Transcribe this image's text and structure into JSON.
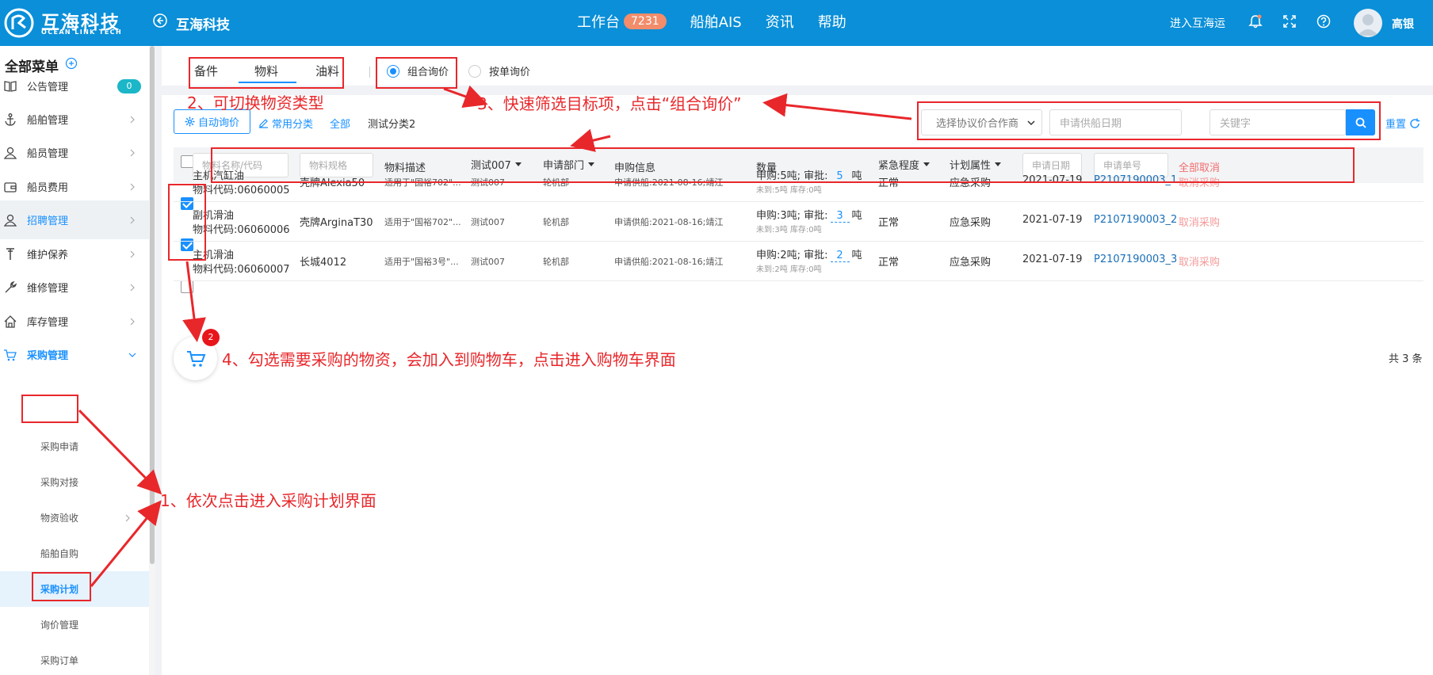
{
  "header": {
    "logo_cn": "互海科技",
    "logo_en": "OCEAN LINK TECH",
    "company": "互海科技",
    "nav": [
      {
        "label": "工作台",
        "badge": "7231"
      },
      {
        "label": "船舶AIS"
      },
      {
        "label": "资讯"
      },
      {
        "label": "帮助"
      }
    ],
    "enter_link": "进入互海运",
    "user_name": "高银",
    "colors": {
      "bar": "#0a8fd8",
      "badge": "#f28c6a"
    }
  },
  "sidebar": {
    "title": "全部菜单",
    "items": [
      {
        "label": "公告管理",
        "icon": "book-icon",
        "badge": "0"
      },
      {
        "label": "船舶管理",
        "icon": "anchor-icon"
      },
      {
        "label": "船员管理",
        "icon": "user-icon"
      },
      {
        "label": "船员费用",
        "icon": "wallet-icon"
      },
      {
        "label": "招聘管理",
        "icon": "user-icon"
      },
      {
        "label": "维护保养",
        "icon": "tool-icon"
      },
      {
        "label": "维修管理",
        "icon": "wrench-icon"
      },
      {
        "label": "库存管理",
        "icon": "home-icon"
      },
      {
        "label": "采购管理",
        "icon": "cart-icon"
      }
    ],
    "sub_items": [
      "采购申请",
      "采购对接",
      "物资验收",
      "船舶自购",
      "采购计划",
      "询价管理",
      "采购订单"
    ]
  },
  "tabs": [
    "备件",
    "物料",
    "油料"
  ],
  "radios": [
    "组合询价",
    "按单询价"
  ],
  "toolbar": {
    "auto_inquiry": "自动询价",
    "common_category": "常用分类",
    "all": "全部",
    "test_category": "测试分类2",
    "supplier_select": "选择协议价合作商",
    "date_placeholder": "申请供船日期",
    "keyword_placeholder": "关键字",
    "reset": "重置"
  },
  "table": {
    "headers": {
      "name_placeholder": "物料名称/代码",
      "spec_placeholder": "物料规格",
      "desc": "物料描述",
      "test007": "测试007",
      "dept": "申请部门",
      "info": "申购信息",
      "qty": "数量",
      "urgency": "紧急程度",
      "plan_attr": "计划属性",
      "date_placeholder": "申请日期",
      "no_placeholder": "申请单号",
      "cancel_all": "全部取消"
    },
    "rows": [
      {
        "name": "主机汽缸油",
        "code": "物料代码:06060005",
        "spec": "壳牌Alexia50",
        "desc": "适用于\"国裕702\"...",
        "test": "测试007",
        "dept": "轮机部",
        "info": "申请供船:2021-08-16;靖江",
        "apply": "申购:5吨; 审批:",
        "approve": "5",
        "unit": "吨",
        "sub": "未到:5吨 库存:0吨",
        "urgency": "正常",
        "attr": "应急采购",
        "date": "2021-07-19",
        "no": "P2107190003_1",
        "action": "取消采购",
        "checked": true
      },
      {
        "name": "副机滑油",
        "code": "物料代码:06060006",
        "spec": "壳牌ArginaT30",
        "desc": "适用于\"国裕702\"...",
        "test": "测试007",
        "dept": "轮机部",
        "info": "申请供船:2021-08-16;靖江",
        "apply": "申购:3吨; 审批:",
        "approve": "3",
        "unit": "吨",
        "sub": "未到:3吨 库存:0吨",
        "urgency": "正常",
        "attr": "应急采购",
        "date": "2021-07-19",
        "no": "P2107190003_2",
        "action": "取消采购",
        "checked": true
      },
      {
        "name": "主机滑油",
        "code": "物料代码:06060007",
        "spec": "长城4012",
        "desc": "适用于\"国裕3号\"...",
        "test": "测试007",
        "dept": "轮机部",
        "info": "申请供船:2021-08-16;靖江",
        "apply": "申购:2吨; 审批:",
        "approve": "2",
        "unit": "吨",
        "sub": "未到:2吨 库存:0吨",
        "urgency": "正常",
        "attr": "应急采购",
        "date": "2021-07-19",
        "no": "P2107190003_3",
        "action": "取消采购",
        "checked": false
      }
    ],
    "total": "共 3 条"
  },
  "cart": {
    "count": "2"
  },
  "annotations": {
    "note1": "1、依次点击进入采购计划界面",
    "note2": "2、可切换物资类型",
    "note3": "3、快速筛选目标项，点击“组合询价”",
    "note4": "4、勾选需要采购的物资，会加入到购物车，点击进入购物车界面",
    "color": "#e8272b"
  }
}
